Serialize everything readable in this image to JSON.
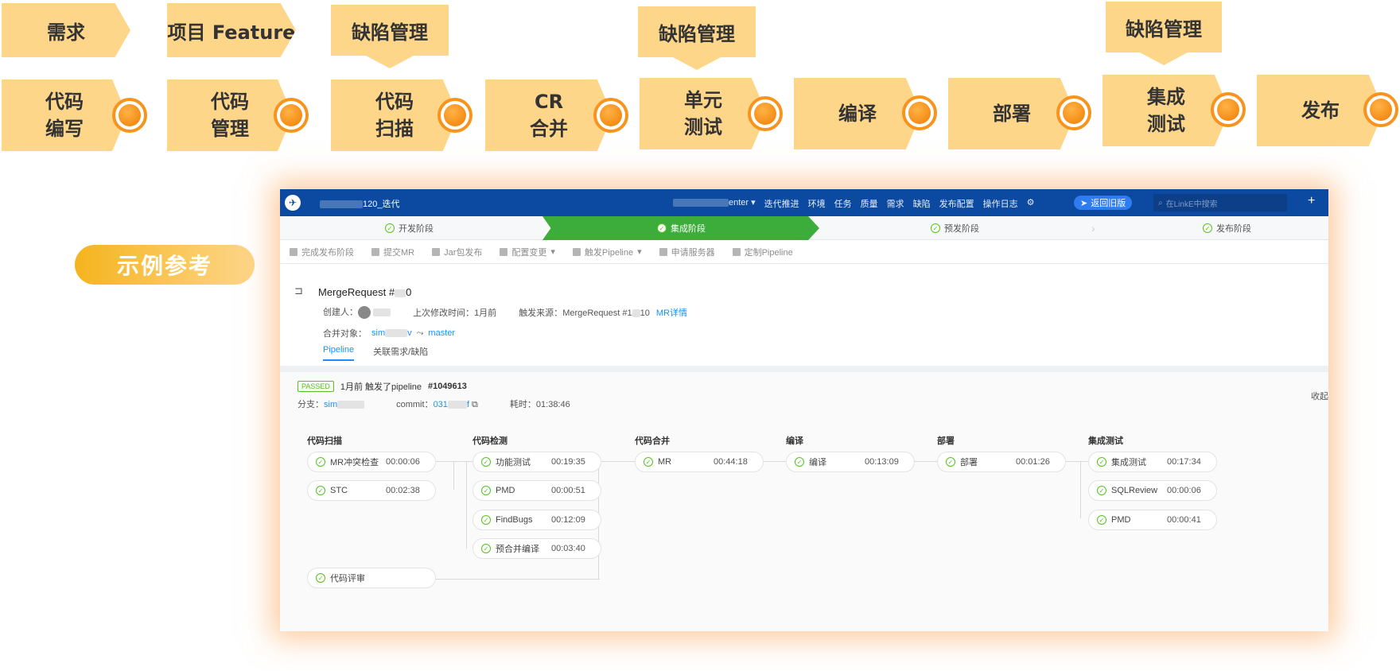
{
  "flow": {
    "top_chevrons": [
      "需求",
      "项目 Feature"
    ],
    "callouts": [
      "缺陷管理",
      "缺陷管理",
      "缺陷管理"
    ],
    "steps": [
      "代码\n编写",
      "代码\n管理",
      "代码\n扫描",
      "CR\n合并",
      "单元\n测试",
      "编译",
      "部署",
      "集成\n测试",
      "发布"
    ]
  },
  "example_label": "示例参考",
  "window": {
    "project_title_suffix": "120_迭代",
    "top_menu": [
      "迭代推进",
      "环境",
      "任务",
      "质量",
      "需求",
      "缺陷",
      "发布配置",
      "操作日志"
    ],
    "user_suffix": "enter",
    "back_button": "返回旧版",
    "search_placeholder": "在LinkE中搜索",
    "stages": [
      "开发阶段",
      "集成阶段",
      "预发阶段",
      "发布阶段"
    ],
    "toolbar": [
      "完成发布阶段",
      "提交MR",
      "Jar包发布",
      "配置变更",
      "触发Pipeline",
      "申请服务器",
      "定制Pipeline"
    ],
    "mr_title": "MergeRequest #",
    "mr_title_tail": "0",
    "creator_label": "创建人：",
    "modified_label": "上次修改时间：",
    "modified_value": "1月前",
    "trigger_label": "触发来源：",
    "trigger_value": "MergeRequest #1",
    "trigger_tail": "10",
    "mr_detail_link": "MR详情",
    "merge_target_label": "合并对象：",
    "merge_source": "sim",
    "merge_source_tail": "v",
    "merge_target": "master",
    "tabs": [
      "Pipeline",
      "关联需求/缺陷"
    ],
    "passed_badge": "PASSED",
    "pipeline_prefix": "1月前 触发了pipeline",
    "pipeline_id": "#1049613",
    "branch_label": "分支：",
    "branch_value": "sim",
    "commit_label": "commit：",
    "commit_value": "031",
    "commit_tail": "f",
    "duration_label": "耗时：",
    "duration_value": "01:38:46",
    "collapse": "收起",
    "stage_columns": [
      {
        "title": "代码扫描",
        "jobs": [
          {
            "name": "MR冲突检查",
            "time": "00:00:06"
          },
          {
            "name": "STC",
            "time": "00:02:38"
          }
        ]
      },
      {
        "title": "代码检测",
        "jobs": [
          {
            "name": "功能测试",
            "time": "00:19:35"
          },
          {
            "name": "PMD",
            "time": "00:00:51"
          },
          {
            "name": "FindBugs",
            "time": "00:12:09"
          },
          {
            "name": "预合并编译",
            "time": "00:03:40"
          }
        ]
      },
      {
        "title": "代码合并",
        "jobs": [
          {
            "name": "MR",
            "time": "00:44:18"
          }
        ]
      },
      {
        "title": "编译",
        "jobs": [
          {
            "name": "编译",
            "time": "00:13:09"
          }
        ]
      },
      {
        "title": "部署",
        "jobs": [
          {
            "name": "部署",
            "time": "00:01:26"
          }
        ]
      },
      {
        "title": "集成测试",
        "jobs": [
          {
            "name": "集成测试",
            "time": "00:17:34"
          },
          {
            "name": "SQLReview",
            "time": "00:00:06"
          },
          {
            "name": "PMD",
            "time": "00:00:41"
          }
        ]
      }
    ],
    "review_job": {
      "name": "代码评审",
      "time": ""
    }
  },
  "colors": {
    "chevron": "#fdd68a",
    "dot": "#f7941d",
    "nav": "#0b4aa0",
    "active_stage": "#3cad3a",
    "link": "#1890ff"
  }
}
